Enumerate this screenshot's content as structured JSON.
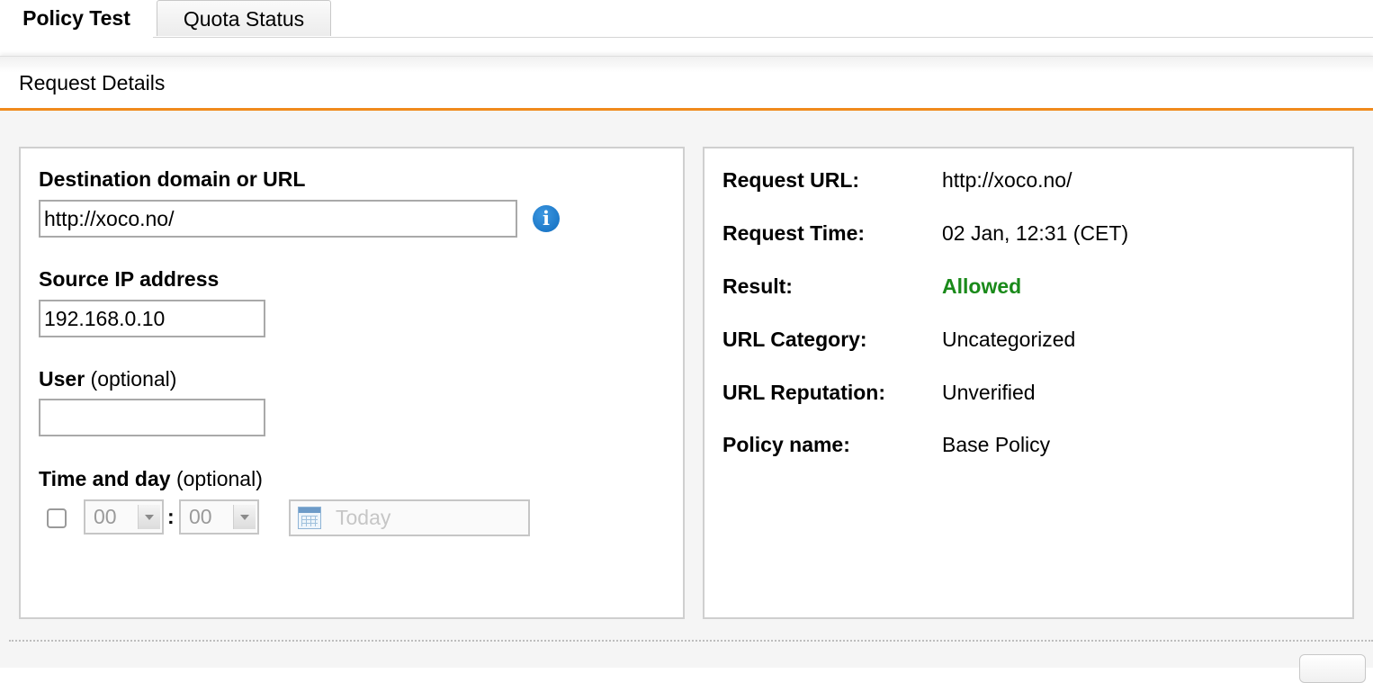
{
  "tabs": [
    {
      "label": "Policy Test",
      "active": true
    },
    {
      "label": "Quota Status",
      "active": false
    }
  ],
  "section": {
    "title": "Request Details"
  },
  "form": {
    "destination": {
      "label": "Destination domain or URL",
      "value": "http://xoco.no/"
    },
    "source_ip": {
      "label": "Source IP address",
      "value": "192.168.0.10"
    },
    "user": {
      "label": "User",
      "optional": "(optional)",
      "value": ""
    },
    "time_day": {
      "label": "Time and day",
      "optional": "(optional)",
      "hour": "00",
      "minute": "00",
      "separator": ":",
      "date_placeholder": "Today",
      "enabled": false
    }
  },
  "details": {
    "request_url": {
      "label": "Request URL:",
      "value": "http://xoco.no/"
    },
    "request_time": {
      "label": "Request Time:",
      "value": "02 Jan, 12:31 (CET)"
    },
    "result": {
      "label": "Result:",
      "value": "Allowed"
    },
    "url_category": {
      "label": "URL Category:",
      "value": "Uncategorized"
    },
    "url_reputation": {
      "label": "URL Reputation:",
      "value": "Unverified"
    },
    "policy_name": {
      "label": "Policy name:",
      "value": "Base Policy"
    }
  },
  "colors": {
    "accent": "#f08a1c",
    "allowed": "#1a8a1a",
    "info": "#1a73c4"
  },
  "icons": {
    "info": "info-icon",
    "calendar": "calendar-icon"
  }
}
